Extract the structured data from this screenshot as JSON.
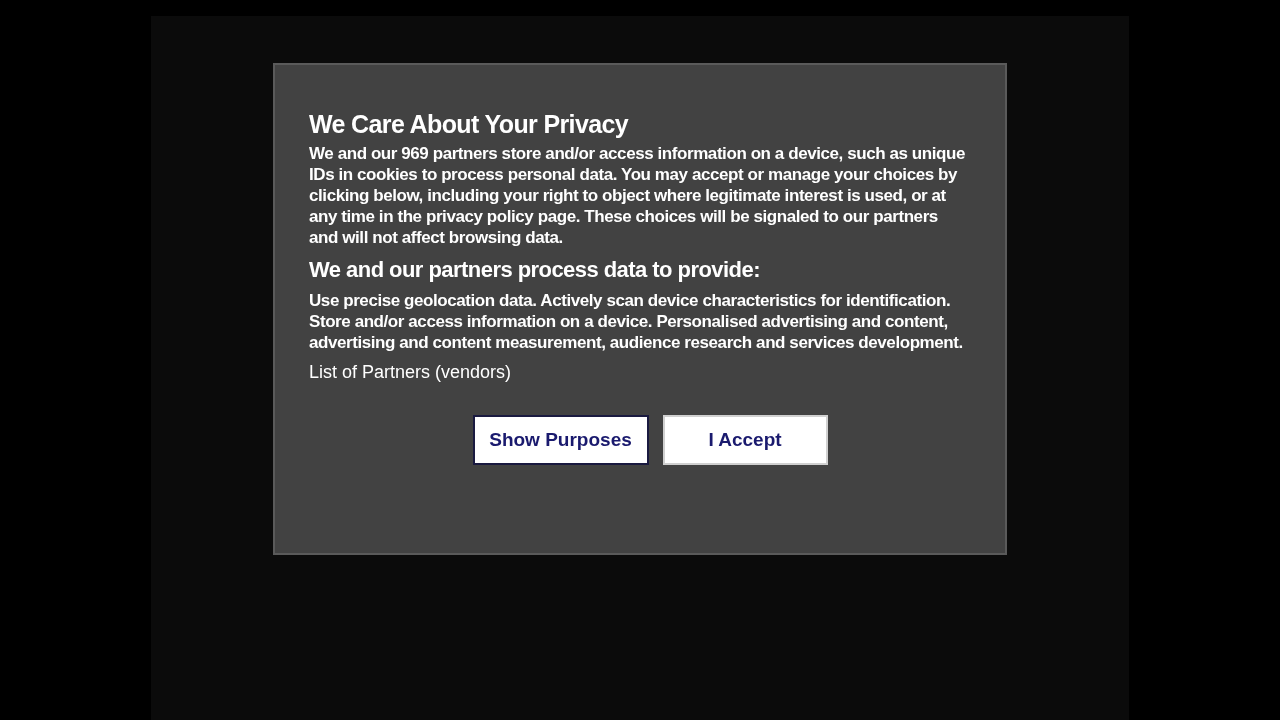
{
  "dialog": {
    "title": "We Care About Your Privacy",
    "intro": "We and our 969 partners store and/or access information on a device, such as unique IDs in cookies to process personal data. You may accept or manage your choices by clicking below, including your right to object where legitimate interest is used, or at any time in the privacy policy page. These choices will be signaled to our partners and will not affect browsing data.",
    "subtitle": "We and our partners process data to provide:",
    "purposes": "Use precise geolocation data. Actively scan device characteristics for identification. Store and/or access information on a device. Personalised advertising and content, advertising and content measurement, audience research and services development.",
    "partners_link": "List of Partners (vendors)",
    "buttons": [
      {
        "label": "Show Purposes",
        "kind": "secondary"
      },
      {
        "label": "I Accept",
        "kind": "primary"
      }
    ]
  }
}
